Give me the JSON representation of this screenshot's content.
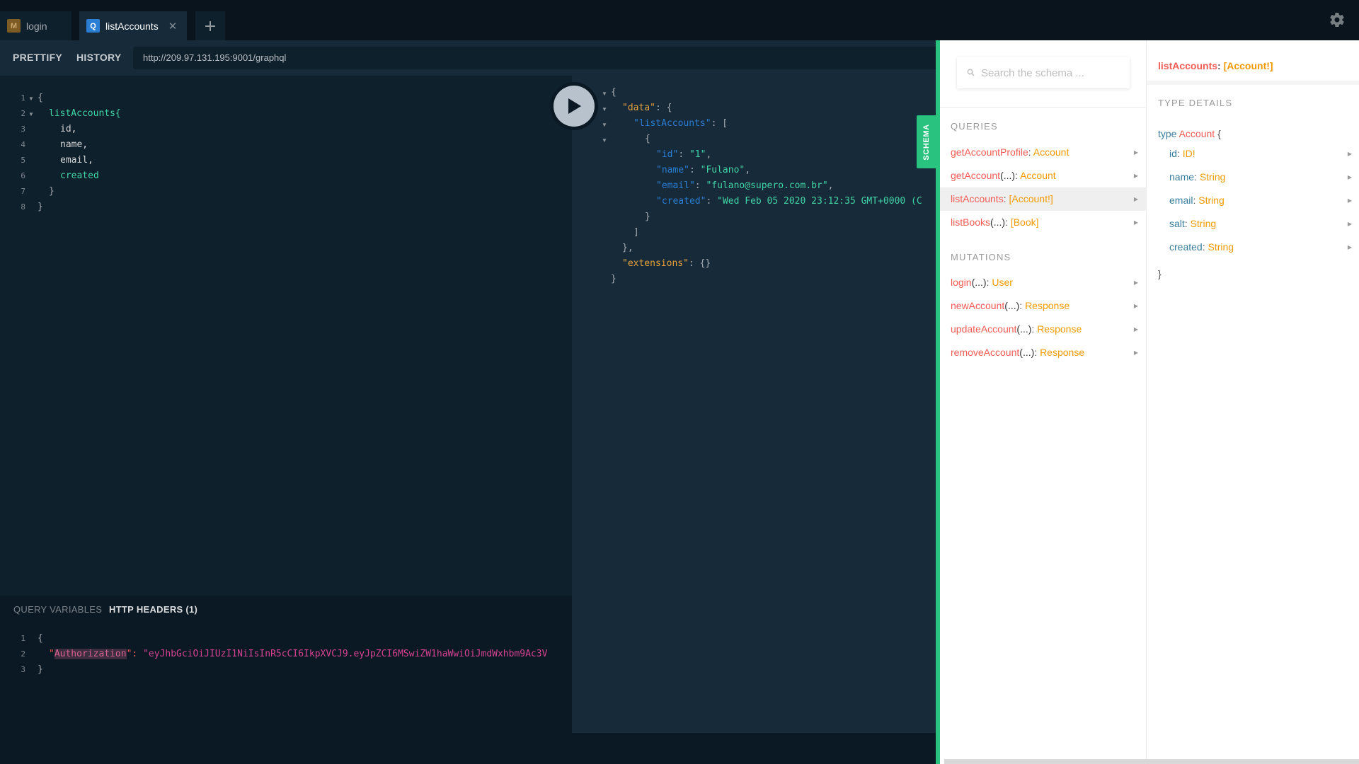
{
  "tabs": [
    {
      "badge": "M",
      "label": "login"
    },
    {
      "badge": "Q",
      "label": "listAccounts",
      "close": "✕"
    }
  ],
  "add_tab": "+",
  "toolbar": {
    "prettify": "PRETTIFY",
    "history": "HISTORY",
    "url": "http://209.97.131.195:9001/graphql"
  },
  "query": {
    "line_numbers": [
      "1",
      "2",
      "3",
      "4",
      "5",
      "6",
      "7",
      "8"
    ],
    "lines": [
      "{",
      "listAccounts{",
      "id,",
      "name,",
      "email,",
      "created",
      "}",
      "}"
    ]
  },
  "variables": {
    "tab_query_vars": "QUERY VARIABLES",
    "tab_http_headers": "HTTP HEADERS (1)",
    "line_numbers": [
      "1",
      "2",
      "3"
    ],
    "open": "{",
    "header_key": "Authorization",
    "header_value": "\"eyJhbGciOiJIUzI1NiIsInR5cCI6IkpXVCJ9.eyJpZCI6MSwiZW1haWwiOiJmdWxhbm9Ac3V",
    "close": "}"
  },
  "result": {
    "data_key": "\"data\"",
    "list_key": "\"listAccounts\"",
    "item": {
      "id_key": "\"id\"",
      "id_val": "\"1\"",
      "name_key": "\"name\"",
      "name_val": "\"Fulano\"",
      "email_key": "\"email\"",
      "email_val": "\"fulano@supero.com.br\"",
      "created_key": "\"created\"",
      "created_val": "\"Wed Feb 05 2020 23:12:35 GMT+0000 (C"
    },
    "extensions_key": "\"extensions\"",
    "extensions_val": "{}"
  },
  "schema_tab": "SCHEMA",
  "docs": {
    "search_placeholder": "Search the schema ...",
    "queries_title": "QUERIES",
    "queries": [
      {
        "name": "getAccountProfile",
        "args": "",
        "type": "Account"
      },
      {
        "name": "getAccount",
        "args": "(...)",
        "type": "Account"
      },
      {
        "name": "listAccounts",
        "args": "",
        "type": "[Account!]",
        "selected": true
      },
      {
        "name": "listBooks",
        "args": "(...)",
        "type": "[Book]"
      }
    ],
    "mutations_title": "MUTATIONS",
    "mutations": [
      {
        "name": "login",
        "args": "(...)",
        "type": "User"
      },
      {
        "name": "newAccount",
        "args": "(...)",
        "type": "Response"
      },
      {
        "name": "updateAccount",
        "args": "(...)",
        "type": "Response"
      },
      {
        "name": "removeAccount",
        "args": "(...)",
        "type": "Response"
      }
    ],
    "detail": {
      "field": "listAccounts",
      "type": "[Account!]",
      "type_details_title": "TYPE DETAILS",
      "type_keyword": "type",
      "type_name": "Account",
      "fields": [
        {
          "name": "id",
          "type": "ID!"
        },
        {
          "name": "name",
          "type": "String"
        },
        {
          "name": "email",
          "type": "String"
        },
        {
          "name": "salt",
          "type": "String"
        },
        {
          "name": "created",
          "type": "String"
        }
      ]
    }
  },
  "colors": {
    "accent_green": "#29c27f",
    "field_red": "#f25c54",
    "type_orange": "#f29a00",
    "query_badge": "#2a7ed3"
  },
  "icons": [
    "settings-gear-icon",
    "run-play-icon",
    "search-icon",
    "chevron-right-icon",
    "close-icon",
    "plus-icon"
  ]
}
